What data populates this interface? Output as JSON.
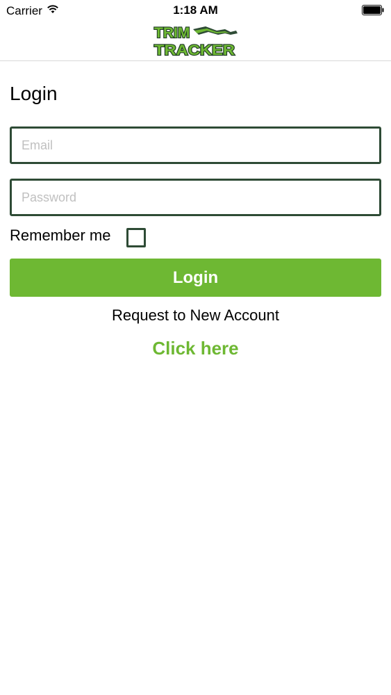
{
  "status_bar": {
    "carrier": "Carrier",
    "time": "1:18 AM",
    "wifi_icon": "wifi-icon",
    "battery_icon": "battery-icon"
  },
  "nav": {
    "logo_line1": "TRIM",
    "logo_line2": "TRACKER"
  },
  "login_form": {
    "title": "Login",
    "email_placeholder": "Email",
    "email_value": "",
    "password_placeholder": "Password",
    "password_value": "",
    "remember_label": "Remember me",
    "remember_checked": false,
    "submit_label": "Login"
  },
  "signup": {
    "prompt": "Request to New Account",
    "link_label": "Click here"
  },
  "colors": {
    "accent_green": "#6eb833",
    "border_dark_green": "#2e4b35"
  }
}
